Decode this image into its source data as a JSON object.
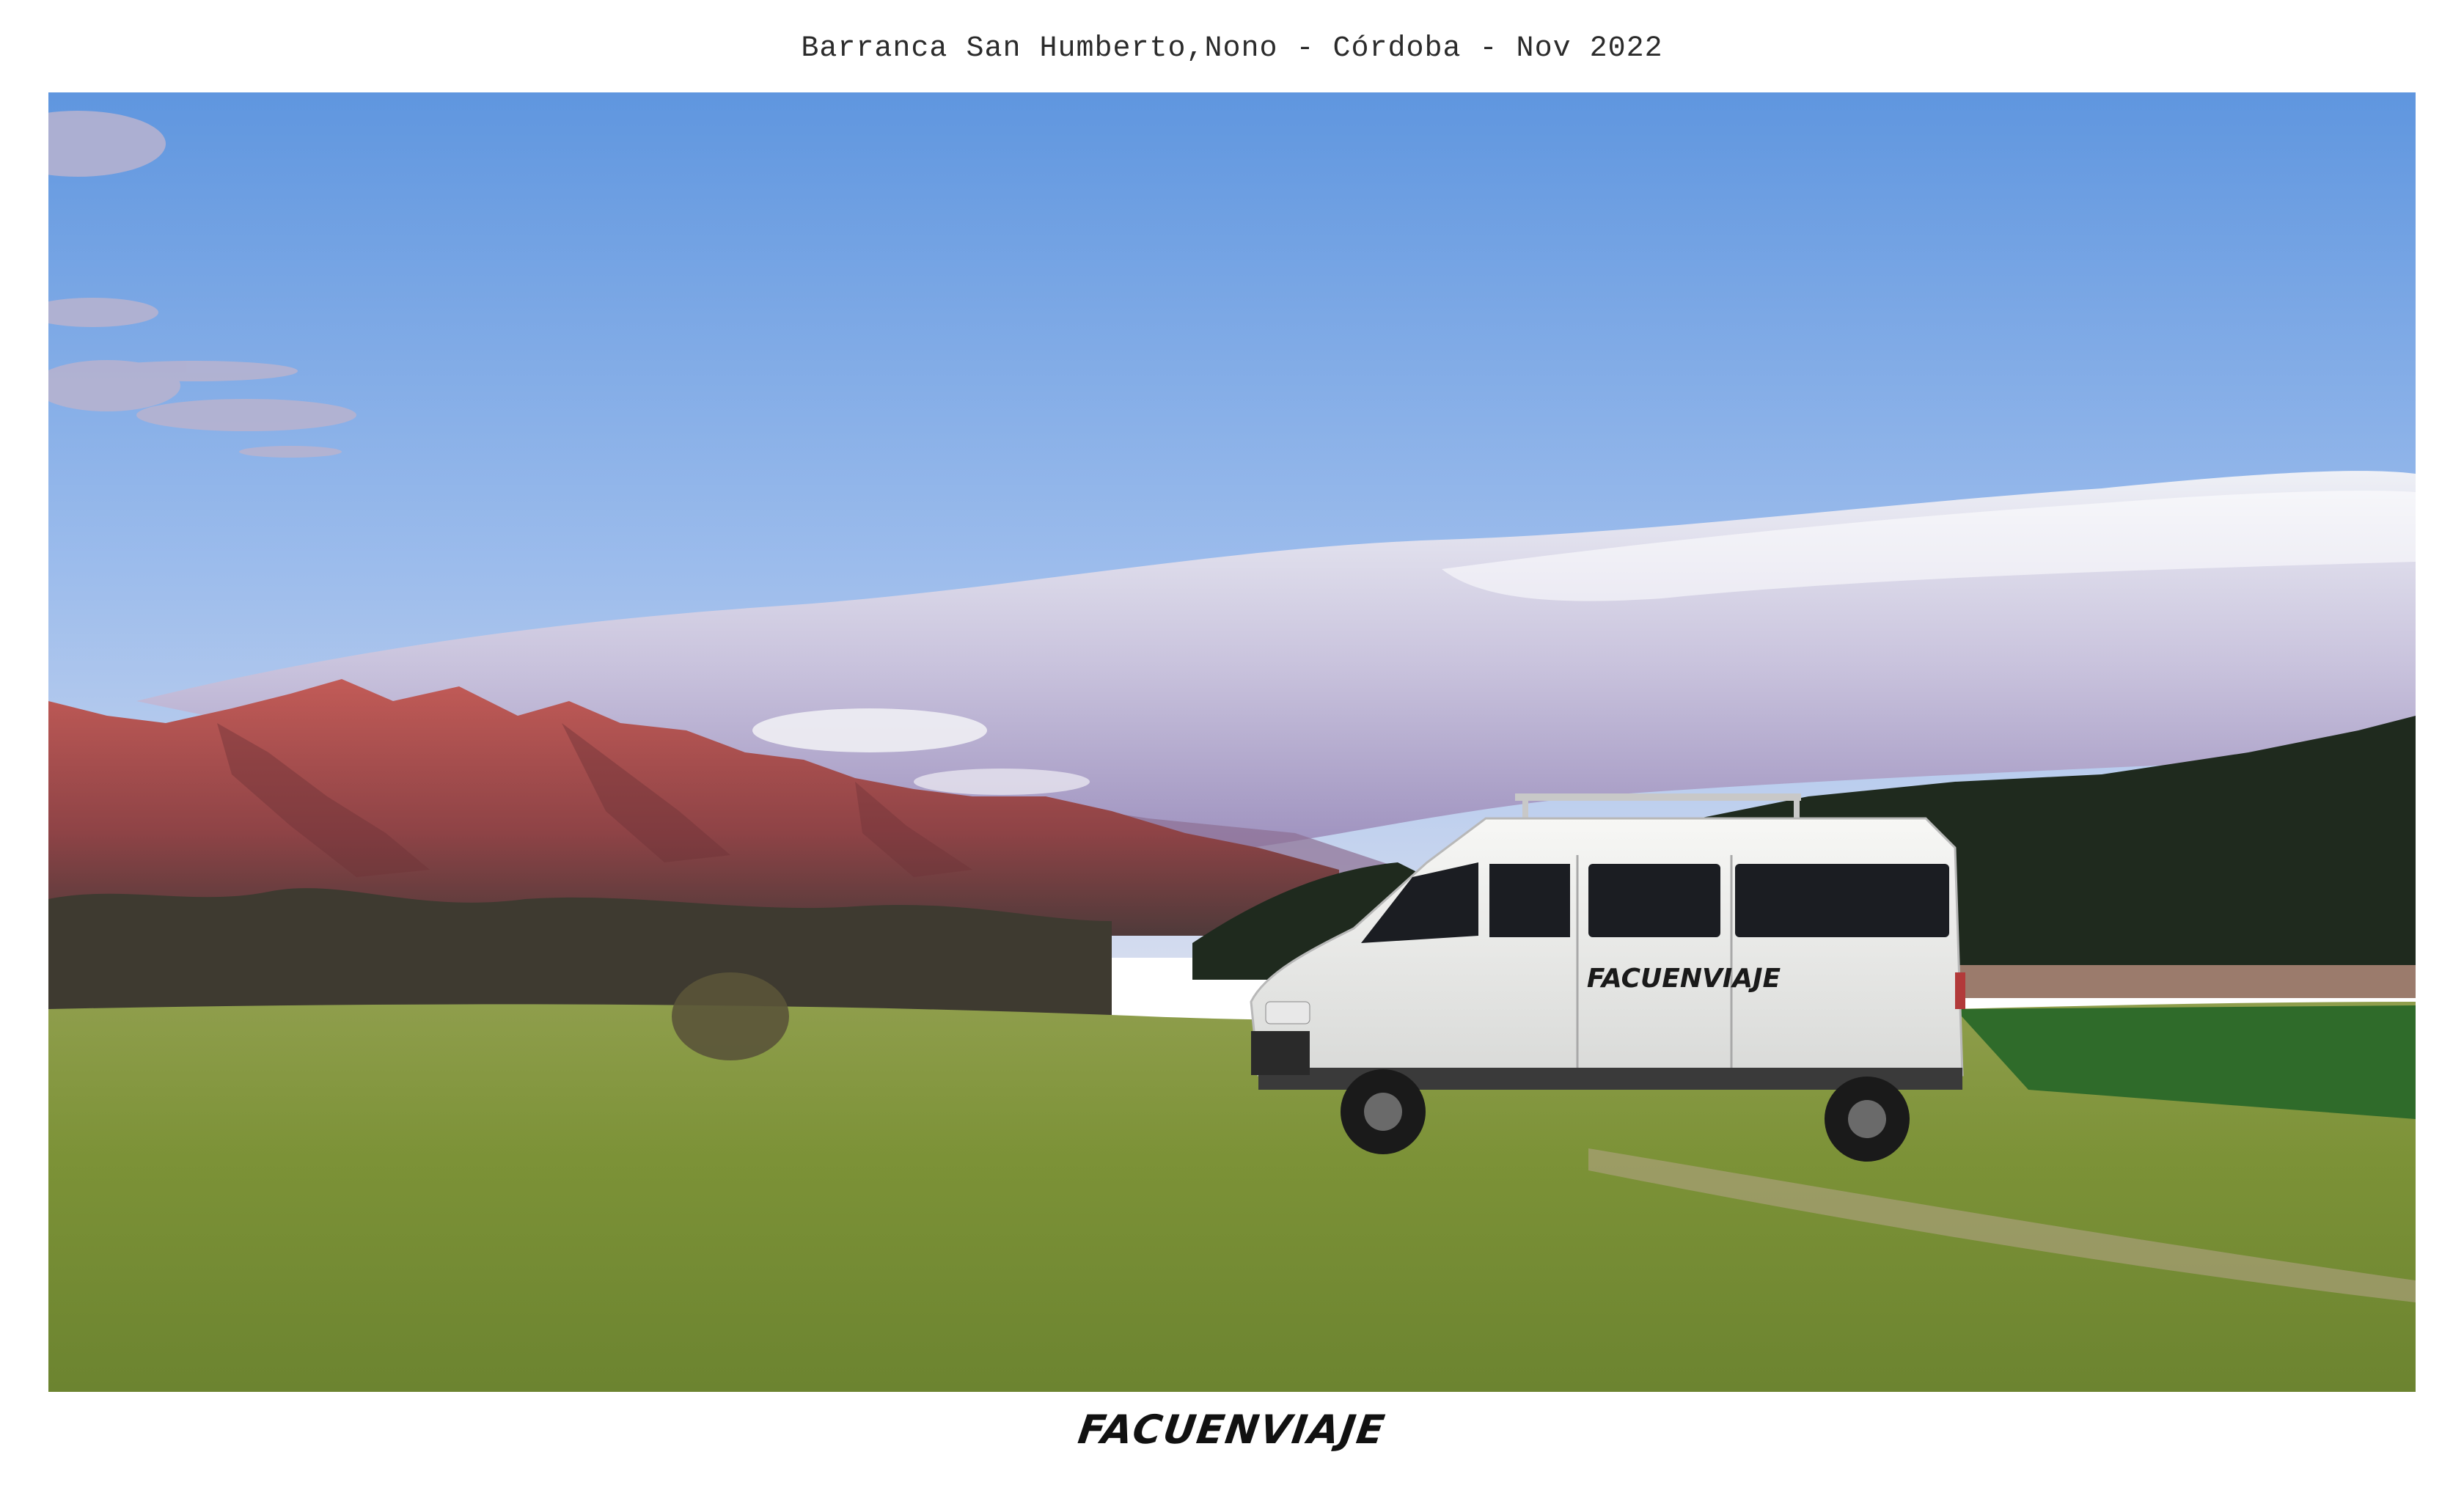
{
  "caption": "Barranca San Humberto,Nono - Córdoba - Nov 2022",
  "signature": "FACUENVIAJE",
  "van_decal": "FACUENVIAJE",
  "colors": {
    "sky_top": "#5f99e0",
    "sky_bottom": "#cfd9ef",
    "mountains": "#b2524f",
    "grass": "#7f953c",
    "van": "#f3f3f1"
  }
}
